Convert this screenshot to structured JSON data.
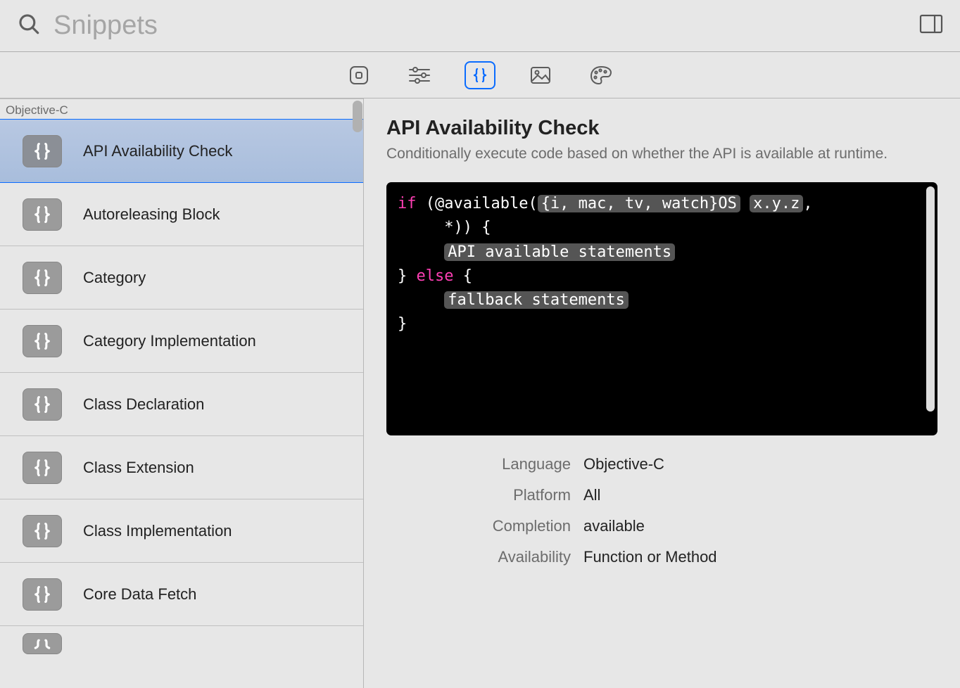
{
  "search": {
    "placeholder": "Snippets"
  },
  "toolbar": {
    "buttons": [
      "views",
      "modifiers",
      "snippets",
      "media",
      "colors"
    ],
    "selected_index": 2
  },
  "sidebar": {
    "section": "Objective-C",
    "selected_index": 0,
    "items": [
      {
        "label": "API Availability Check"
      },
      {
        "label": "Autoreleasing Block"
      },
      {
        "label": "Category"
      },
      {
        "label": "Category Implementation"
      },
      {
        "label": "Class Declaration"
      },
      {
        "label": "Class Extension"
      },
      {
        "label": "Class Implementation"
      },
      {
        "label": "Core Data Fetch"
      }
    ]
  },
  "detail": {
    "title": "API Availability Check",
    "description": "Conditionally execute code based on whether the API is available at runtime.",
    "code": {
      "kw_if": "if",
      "open": " (@available(",
      "token_platforms": "{i, mac, tv, watch}OS",
      "space1": " ",
      "token_version": "x.y.z",
      "tail1": ",\n     *)) {",
      "indent": "\n     ",
      "token_avail": "API available statements",
      "mid": "\n} ",
      "kw_else": "else",
      "mid2": " {",
      "token_fb": "fallback statements",
      "end": "\n}"
    },
    "meta": {
      "language_label": "Language",
      "language_value": "Objective-C",
      "platform_label": "Platform",
      "platform_value": "All",
      "completion_label": "Completion",
      "completion_value": "available",
      "availability_label": "Availability",
      "availability_value": "Function or Method"
    }
  }
}
